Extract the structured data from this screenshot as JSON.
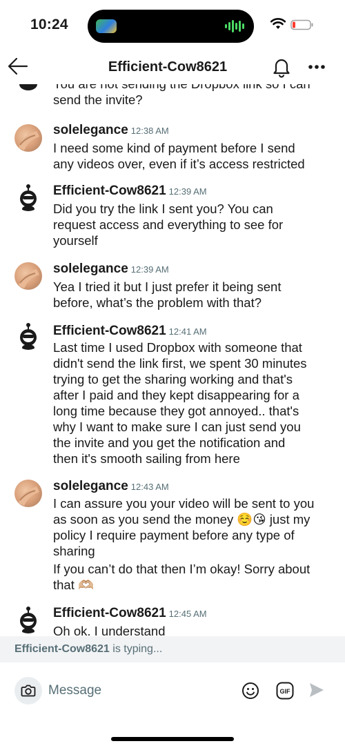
{
  "status_bar": {
    "time": "10:24"
  },
  "header": {
    "title": "Efficient-Cow8621"
  },
  "messages": [
    {
      "author": "",
      "time": "",
      "lines": [
        "You are not sending the Dropbox link so I can",
        "send the invite?"
      ]
    },
    {
      "author": "solelegance",
      "time": "12:38 AM",
      "lines": [
        "I need some kind of payment before I send",
        "any videos over, even if it’s access restricted"
      ]
    },
    {
      "author": "Efficient-Cow8621",
      "time": "12:39 AM",
      "lines": [
        "Did you try the link I sent you? You can",
        "request access and everything to see for",
        "yourself"
      ]
    },
    {
      "author": "solelegance",
      "time": "12:39 AM",
      "lines": [
        "Yea I tried it but I just prefer it being sent",
        "before, what’s the problem with that?"
      ]
    },
    {
      "author": "Efficient-Cow8621",
      "time": "12:41 AM",
      "lines": [
        "Last time I used Dropbox with someone that",
        "didn't send the link first, we spent 30 minutes",
        "trying to get the sharing working and that's",
        "after I paid and they kept disappearing for a",
        "long time because they got annoyed.. that's",
        "why I want to make sure I can just send you",
        "the invite and you get the notification and",
        "then it's smooth sailing from here"
      ]
    },
    {
      "author": "solelegance",
      "time": "12:43 AM",
      "lines": [
        "I can assure you your video will be sent to you",
        "as soon as you send the money ☺️😘 just my",
        "policy I require payment before any type of",
        "sharing"
      ],
      "extra_lines": [
        "If you can’t do that then I’m okay! Sorry about",
        "that 🫶🏼"
      ]
    },
    {
      "author": "Efficient-Cow8621",
      "time": "12:45 AM",
      "lines": [
        "Oh ok. I understand"
      ]
    }
  ],
  "typing": {
    "name": "Efficient-Cow8621",
    "text": " is typing..."
  },
  "composer": {
    "placeholder": "Message"
  },
  "icons": {
    "back": "arrow-left-icon",
    "bell": "bell-icon",
    "more": "more-horizontal-icon",
    "camera": "camera-icon",
    "emoji": "emoji-icon",
    "gif": "gif-icon",
    "send": "send-icon"
  },
  "colors": {
    "text": "#1a1a1b",
    "meta": "#576f76",
    "typing_bg": "#f2f3f5",
    "input_bg": "#eaedef"
  }
}
